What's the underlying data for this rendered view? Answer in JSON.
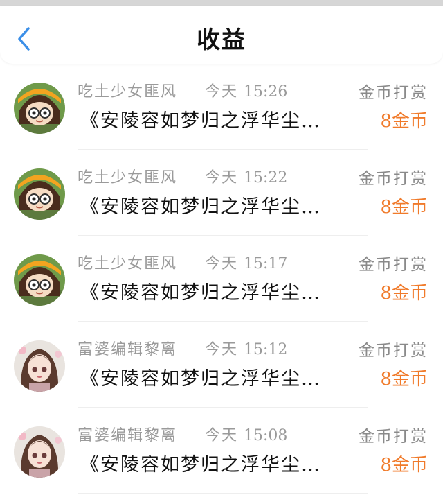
{
  "header": {
    "title": "收益",
    "back_icon": "chevron-left-icon",
    "accent_color": "#3b8fe8"
  },
  "colors": {
    "amount": "#f07a2a",
    "meta_text": "#9a9a9a"
  },
  "records": [
    {
      "user": "吃土少女匪风",
      "day": "今天",
      "time": "15:26",
      "type": "金币打赏",
      "book": "《安陵容如梦归之浮华尘…",
      "amount": "8金币",
      "avatar": "cartoon-girl-glasses"
    },
    {
      "user": "吃土少女匪风",
      "day": "今天",
      "time": "15:22",
      "type": "金币打赏",
      "book": "《安陵容如梦归之浮华尘…",
      "amount": "8金币",
      "avatar": "cartoon-girl-glasses"
    },
    {
      "user": "吃土少女匪风",
      "day": "今天",
      "time": "15:17",
      "type": "金币打赏",
      "book": "《安陵容如梦归之浮华尘…",
      "amount": "8金币",
      "avatar": "cartoon-girl-glasses"
    },
    {
      "user": "富婆编辑黎离",
      "day": "今天",
      "time": "15:12",
      "type": "金币打赏",
      "book": "《安陵容如梦归之浮华尘…",
      "amount": "8金币",
      "avatar": "anime-girl-portrait"
    },
    {
      "user": "富婆编辑黎离",
      "day": "今天",
      "time": "15:08",
      "type": "金币打赏",
      "book": "《安陵容如梦归之浮华尘…",
      "amount": "8金币",
      "avatar": "anime-girl-portrait"
    }
  ]
}
